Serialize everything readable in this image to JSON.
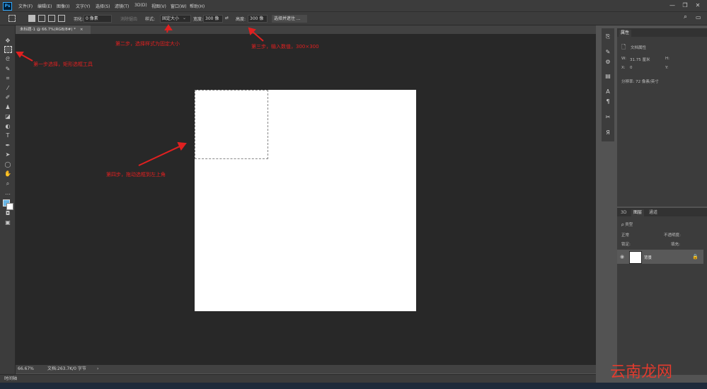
{
  "menu": {
    "logo": "Ps",
    "items": [
      "文件(F)",
      "编辑(E)",
      "图像(I)",
      "文字(Y)",
      "选择(S)",
      "滤镜(T)",
      "3D(D)",
      "视图(V)",
      "窗口(W)",
      "帮助(H)"
    ]
  },
  "window_controls": {
    "minimize": "—",
    "restore": "❐",
    "close": "✕"
  },
  "options": {
    "feather_label": "羽化:",
    "feather_value": "0 像素",
    "antialias": "消除锯齿",
    "style_label": "样式:",
    "style_value": "固定大小",
    "width_label": "宽度:",
    "width_value": "300 像",
    "height_label": "高度:",
    "height_value": "300 像",
    "select_mask": "选择并遮住 ..."
  },
  "document": {
    "tab_title": "未标题-1 @ 66.7%(RGB/8#) *",
    "tab_close": "×"
  },
  "annotations": {
    "step1": "第一步选择，矩形选框工具",
    "step2": "第二步，选择样式为固定大小",
    "step3": "第三步，输入数值，300×300",
    "step4": "第四步，拖动选框到左上角"
  },
  "status": {
    "zoom": "66.67%",
    "doc_info": "文档:263.7K/0 字节"
  },
  "timeline": {
    "label": "时间轴"
  },
  "properties": {
    "tab": "属性",
    "doc_props": "文档属性",
    "w_label": "W:",
    "w_value": "31.75 厘米",
    "h_label": "H:",
    "x_label": "X:",
    "x_value": "0",
    "y_label": "Y:",
    "resolution": "分辨率: 72 像素/英寸"
  },
  "layers": {
    "tabs": [
      "3D",
      "图层",
      "通道"
    ],
    "filter_placeholder": "ρ 类型",
    "blend_mode": "正常",
    "opacity_label": "不透明度:",
    "lock_label": "锁定:",
    "fill_label": "填充:",
    "layer_name": "背景"
  },
  "watermark": "云南龙网",
  "colors": {
    "annotation": "#e02020",
    "accent": "#31a8ff"
  }
}
